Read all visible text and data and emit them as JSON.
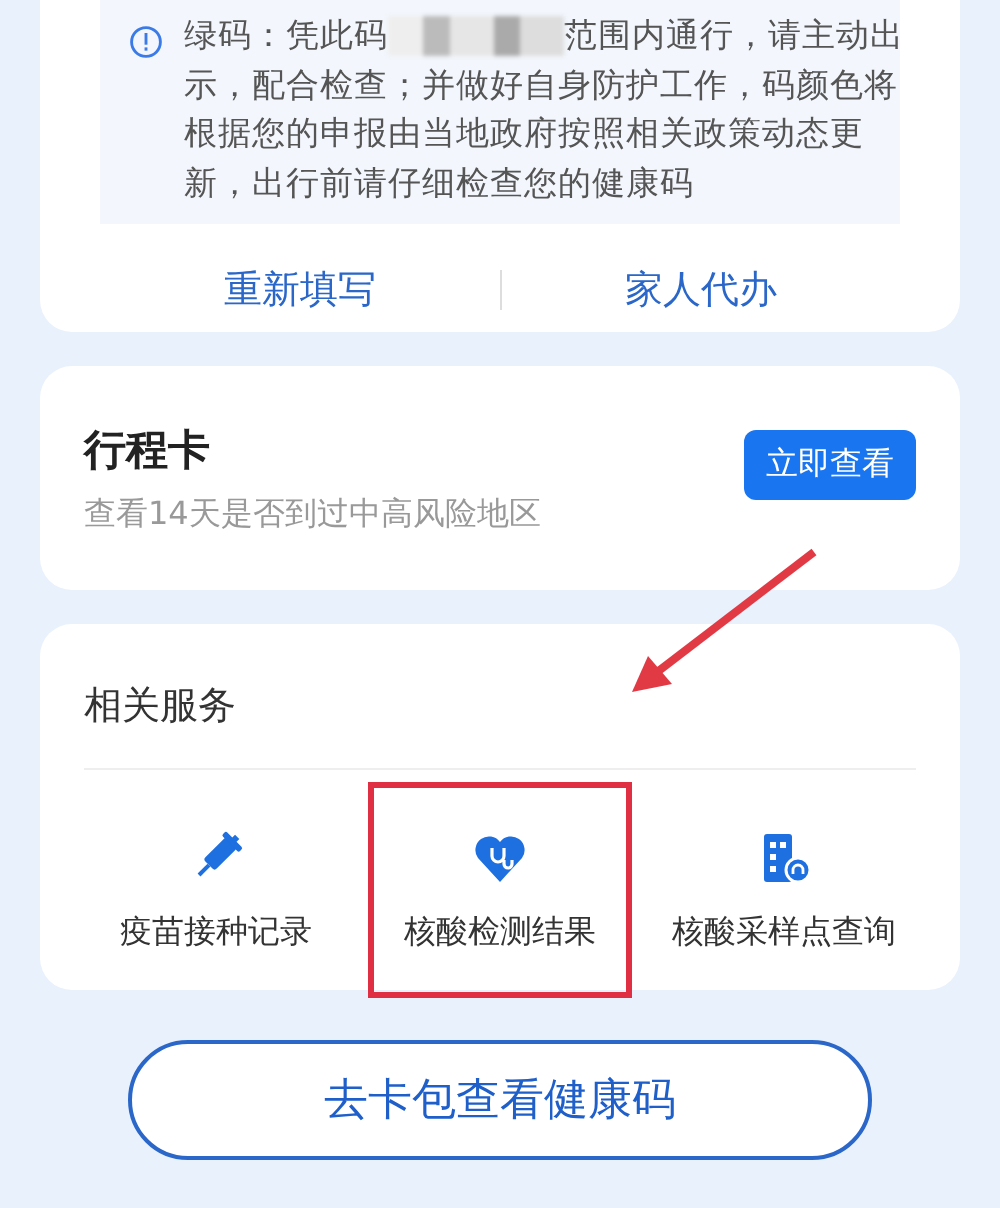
{
  "health_card": {
    "notice": {
      "before": "绿码：凭此码",
      "line_rest": "范围内通行，请主动出",
      "after": "示，配合检查；并做好自身防护工作，码颜色将根据您的申报由当地政府按照相关政策动态更新，出行前请仔细检查您的健康码",
      "redacted": true
    },
    "actions": [
      "重新填写",
      "家人代办"
    ]
  },
  "itinerary_card": {
    "title": "行程卡",
    "subtitle": "查看14天是否到过中高风险地区",
    "button": "立即查看"
  },
  "services": {
    "title": "相关服务",
    "items": [
      {
        "label": "疫苗接种记录",
        "kind": "syringe",
        "highlighted": false
      },
      {
        "label": "核酸检测结果",
        "kind": "heart",
        "highlighted": true
      },
      {
        "label": "核酸采样点查询",
        "kind": "hospital",
        "highlighted": false
      }
    ]
  },
  "bottom_button": "去卡包查看健康码"
}
